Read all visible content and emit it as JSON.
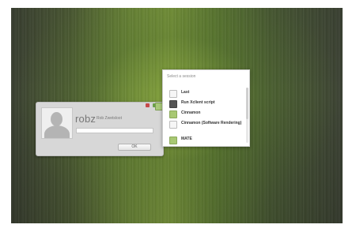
{
  "login": {
    "username": "robz",
    "real_name": "Rob Zwetsloot",
    "ok_label": "OK",
    "avatar_icon": "user-silhouette-icon"
  },
  "sessions": {
    "title": "Select a session",
    "items": [
      {
        "label": "Last",
        "icon": "session-icon"
      },
      {
        "label": "Run Xclient script",
        "icon": "terminal-icon"
      },
      {
        "label": "Cinnamon",
        "icon": "cinnamon-icon"
      },
      {
        "label": "Cinnamon (Software Rendering)",
        "icon": "cinnamon-icon"
      },
      {
        "label": "MATE",
        "icon": "mate-icon"
      }
    ]
  },
  "colors": {
    "accent_green": "#a8c873",
    "badge_red": "#c64a4a",
    "panel_bg": "#d7d7d7"
  }
}
